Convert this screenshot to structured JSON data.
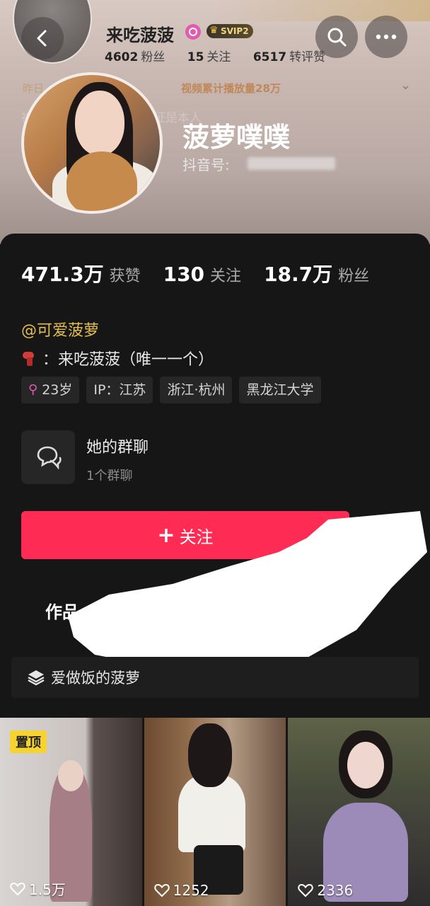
{
  "colors": {
    "accent": "#fe2c55",
    "handle": "#e3bd52",
    "background": "#161616",
    "female_icon": "#e35bb0"
  },
  "header": {
    "mini_name": "来吃菠菠",
    "svip_label": "SVIP2",
    "stats": [
      {
        "value": "4602",
        "label": "粉丝"
      },
      {
        "value": "15",
        "label": "关注"
      },
      {
        "value": "6517",
        "label": "转评赞"
      }
    ],
    "yesterday_label": "昨日",
    "video_plays": "视频累计播放量28万",
    "ghost_line": "被其他人马甲！可视频验证是本人"
  },
  "profile": {
    "name": "菠萝噗噗",
    "douyin_id_label": "抖音号:"
  },
  "stats": [
    {
      "value": "471.3万",
      "label": "获赞"
    },
    {
      "value": "130",
      "label": "关注"
    },
    {
      "value": "18.7万",
      "label": "粉丝"
    }
  ],
  "handle": "@可爱菠萝",
  "bio": "：来吃菠菠（唯一一个）",
  "tags": {
    "age": "23岁",
    "ip": "IP：江苏",
    "location": "浙江·杭州",
    "school": "黑龙江大学"
  },
  "group": {
    "title": "她的群聊",
    "subtitle": "1个群聊"
  },
  "follow_label": "关注",
  "tab_works": "作品",
  "collection": "爱做饭的菠萝",
  "videos": [
    {
      "pinned_label": "置顶",
      "likes": "1.5万"
    },
    {
      "likes": "1252"
    },
    {
      "likes": "2336"
    }
  ],
  "icons": [
    "back-arrow-icon",
    "search-icon",
    "more-icon",
    "chevron-down-icon",
    "group-chat-icon",
    "layers-icon",
    "heart-icon",
    "plus-icon"
  ]
}
